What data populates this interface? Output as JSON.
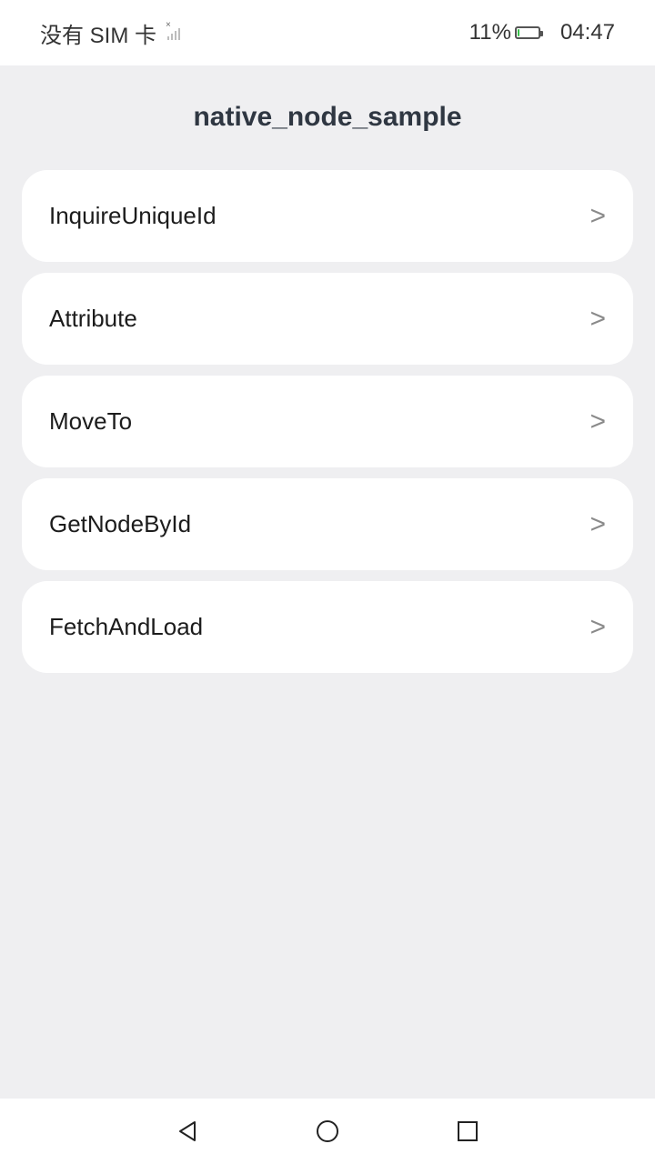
{
  "status_bar": {
    "carrier": "没有 SIM 卡",
    "battery_percent": "11%",
    "battery_level": 0.11,
    "battery_fill_color": "#38c24a",
    "time": "04:47"
  },
  "page": {
    "title": "native_node_sample"
  },
  "list": {
    "items": [
      {
        "label": "InquireUniqueId",
        "arrow": ">"
      },
      {
        "label": "Attribute",
        "arrow": ">"
      },
      {
        "label": "MoveTo",
        "arrow": ">"
      },
      {
        "label": "GetNodeById",
        "arrow": ">"
      },
      {
        "label": "FetchAndLoad",
        "arrow": ">"
      }
    ]
  },
  "nav_bar": {
    "icons": [
      "back-icon",
      "home-icon",
      "recent-apps-icon"
    ]
  }
}
